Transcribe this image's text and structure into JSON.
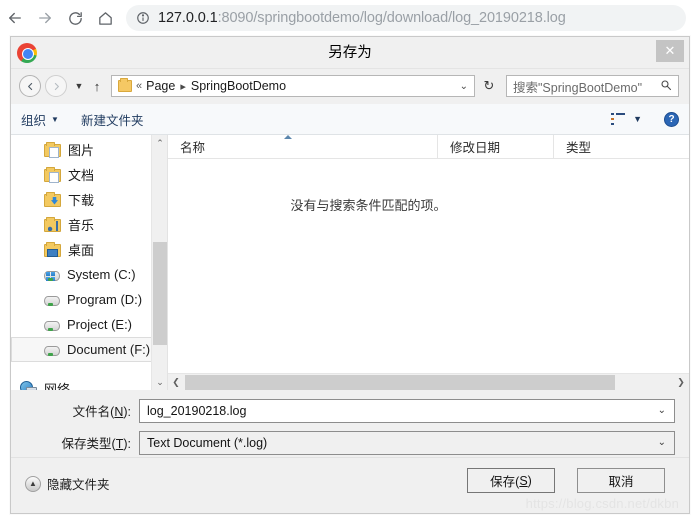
{
  "browser": {
    "back_icon": "back-arrow-icon",
    "forward_icon": "forward-arrow-icon",
    "reload_icon": "reload-icon",
    "home_icon": "home-icon",
    "info_icon": "site-info-icon",
    "url_host": "127.0.0.1",
    "url_path": ":8090/springbootdemo/log/download/log_20190218.log"
  },
  "dialog": {
    "title": "另存为",
    "app_icon": "chrome-logo-icon",
    "close_label": "✕",
    "address": {
      "back_label": "◄",
      "forward_label": "►",
      "recent_caret": "▼",
      "up_label": "↑",
      "folder_icon": "folder-icon",
      "chevrons": "«",
      "crumb_page": "Page",
      "crumb_sep": "▸",
      "crumb_current": "SpringBootDemo",
      "path_caret": "⌄",
      "refresh_label": "↻",
      "search_placeholder": "搜索\"SpringBootDemo\"",
      "search_icon": "search-icon"
    },
    "commandbar": {
      "organize_label": "组织",
      "organize_caret": "▼",
      "new_folder_label": "新建文件夹",
      "view_icon": "view-layout-icon",
      "view_caret": "▼",
      "help_label": "?"
    },
    "nav_pane": {
      "items": [
        {
          "label": "图片",
          "icon": "folder-pictures-icon",
          "kind": "folder",
          "selected": false
        },
        {
          "label": "文档",
          "icon": "folder-documents-icon",
          "kind": "folder",
          "selected": false
        },
        {
          "label": "下载",
          "icon": "folder-downloads-icon",
          "kind": "folder-dl",
          "selected": false
        },
        {
          "label": "音乐",
          "icon": "folder-music-icon",
          "kind": "folder-music",
          "selected": false
        },
        {
          "label": "桌面",
          "icon": "folder-desktop-icon",
          "kind": "folder-desk",
          "selected": false
        },
        {
          "label": "System (C:)",
          "icon": "system-drive-icon",
          "kind": "sysdrive",
          "selected": false
        },
        {
          "label": "Program (D:)",
          "icon": "drive-icon",
          "kind": "drive",
          "selected": false
        },
        {
          "label": "Project (E:)",
          "icon": "drive-icon",
          "kind": "drive",
          "selected": false
        },
        {
          "label": "Document (F:)",
          "icon": "drive-icon",
          "kind": "drive",
          "selected": true
        },
        {
          "label": "网络",
          "icon": "network-icon",
          "kind": "network",
          "selected": false
        }
      ],
      "scroll_up": "⌃",
      "scroll_down": "⌄"
    },
    "file_list": {
      "columns": [
        {
          "label": "名称",
          "sorted": true
        },
        {
          "label": "修改日期",
          "sorted": false
        },
        {
          "label": "类型",
          "sorted": false
        }
      ],
      "rows": [],
      "empty_message": "没有与搜索条件匹配的项。",
      "hscroll_left": "❮",
      "hscroll_right": "❯"
    },
    "form": {
      "filename_label_pre": "文件名(",
      "filename_label_key": "N",
      "filename_label_post": "):",
      "filename_value": "log_20190218.log",
      "savetype_label_pre": "保存类型(",
      "savetype_label_key": "T",
      "savetype_label_post": "):",
      "savetype_value": "Text Document (*.log)",
      "combo_caret": "⌄"
    },
    "footer": {
      "hide_folders_label": "隐藏文件夹",
      "hide_folders_icon": "collapse-up-icon",
      "save_label_pre": "保存(",
      "save_label_key": "S",
      "save_label_post": ")",
      "cancel_label": "取消"
    }
  },
  "watermark": "https://blog.csdn.net/dkbn",
  "colors": {
    "accent": "#2b66b5",
    "dialog_bg": "#f0f0f0",
    "selection_bg": "#f7f7f7",
    "scrollbar_thumb": "#cdcdcd"
  }
}
